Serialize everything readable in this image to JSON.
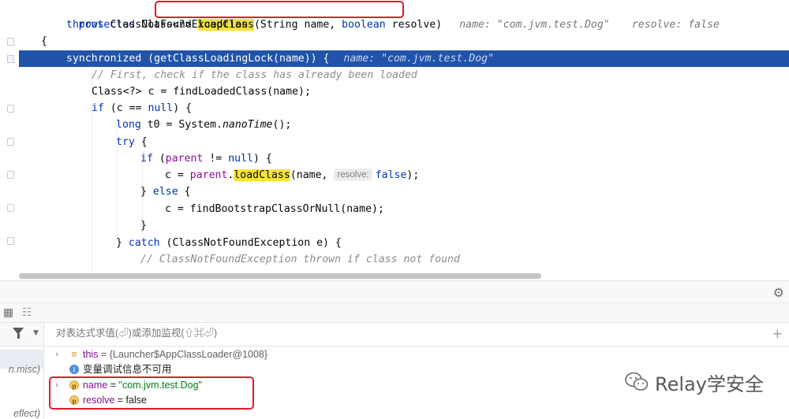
{
  "editor": {
    "lines": [
      {
        "type": "signature",
        "kw": "protected",
        "pre": " Class<?> ",
        "method": "loadClass",
        "params_open": "(String name, ",
        "kw2": "boolean",
        "params_close": " resolve)",
        "inlay1": "name: \"com.jvm.test.Dog\"",
        "inlay2": "resolve: false"
      },
      {
        "kw": "throws",
        "rest": " ClassNotFoundException"
      },
      {
        "rest": "{"
      },
      {
        "kw": "synchronized",
        "rest": " (getClassLoadingLock(name)) {",
        "inlay": "name: \"com.jvm.test.Dog\""
      },
      {
        "comment": "// First, check if the class has already been loaded"
      },
      {
        "rest": "Class<?> c = findLoadedClass(name);"
      },
      {
        "kw": "if",
        "rest_a": " (c == ",
        "kw2": "null",
        "rest_b": ") {"
      },
      {
        "kw": "long",
        "rest_a": " t0 = System.",
        "italic": "nanoTime",
        "rest_b": "();"
      },
      {
        "kw": "try",
        "rest": " {"
      },
      {
        "kw": "if",
        "rest_a": " (",
        "field": "parent",
        "rest_b": " != ",
        "kw2": "null",
        "rest_c": ") {"
      },
      {
        "rest_a": "c = ",
        "field": "parent",
        "dot": ".",
        "method": "loadClass",
        "rest_b": "(name, ",
        "hint": "resolve:",
        "kw2": "false",
        "rest_c": ");"
      },
      {
        "rest_a": "} ",
        "kw": "else",
        "rest_b": " {"
      },
      {
        "rest": "c = findBootstrapClassOrNull(name);"
      },
      {
        "rest": "}"
      },
      {
        "rest_a": "} ",
        "kw": "catch",
        "rest_b": " (ClassNotFoundException e) {"
      },
      {
        "comment": "// ClassNotFoundException thrown if class not found"
      }
    ]
  },
  "debug": {
    "settings_icon": "gear-icon",
    "eval_placeholder": "对表达式求值(⏎)或添加监视(⇧⌘⏎)",
    "frames": [
      "n.misc)",
      "eflect)"
    ],
    "variables": [
      {
        "icon": "≡",
        "name": "this",
        "eq": " = ",
        "value": "{Launcher$AppClassLoader@1008}",
        "expandable": true
      },
      {
        "icon": "i",
        "info": "变量调试信息不可用",
        "expandable": false
      },
      {
        "icon": "p",
        "name": "name",
        "eq": " = ",
        "value": "\"com.jvm.test.Dog\"",
        "expandable": true
      },
      {
        "icon": "p",
        "name": "resolve",
        "eq": " = ",
        "value": "false",
        "expandable": false
      }
    ]
  },
  "watermark": {
    "text": "Relay学安全"
  },
  "colors": {
    "current_line": "#2154a8",
    "highlight": "#f6e33a",
    "annotation": "#e0192b"
  }
}
